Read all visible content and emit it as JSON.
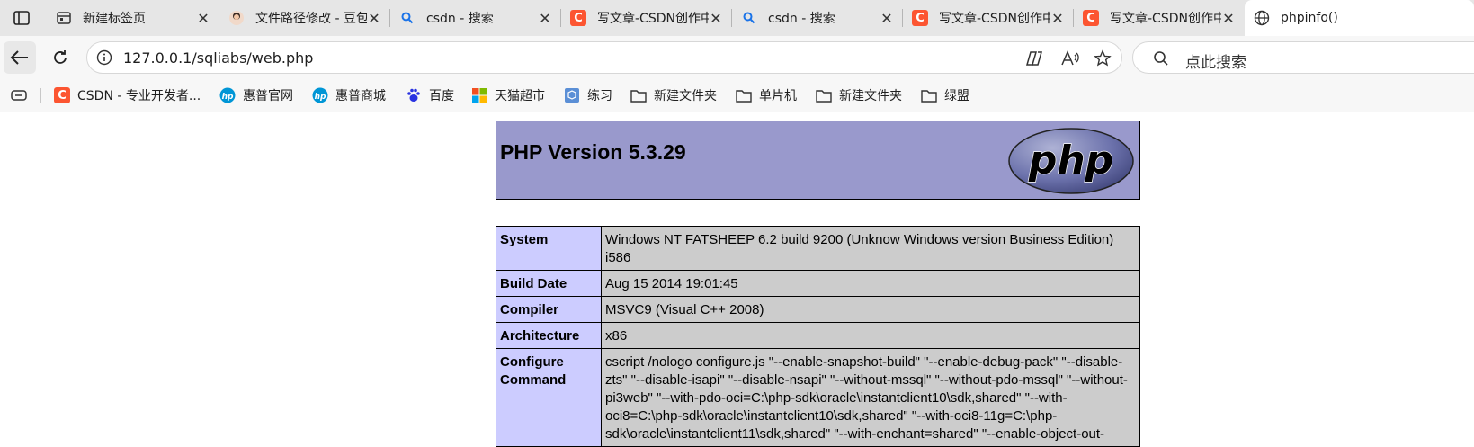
{
  "tabs": [
    {
      "label": "新建标签页",
      "icon": "new-tab-icon"
    },
    {
      "label": "文件路径修改 - 豆包",
      "icon": "doubao-avatar-icon"
    },
    {
      "label": "csdn - 搜索",
      "icon": "search-icon"
    },
    {
      "label": "写文章-CSDN创作中心",
      "icon": "csdn-icon"
    },
    {
      "label": "csdn - 搜索",
      "icon": "search-icon"
    },
    {
      "label": "写文章-CSDN创作中心",
      "icon": "csdn-icon"
    },
    {
      "label": "写文章-CSDN创作中心",
      "icon": "csdn-icon"
    },
    {
      "label": "phpinfo()",
      "icon": "globe-icon",
      "active": true
    }
  ],
  "address_bar": {
    "url": "127.0.0.1/sqliabs/web.php"
  },
  "search_box": {
    "placeholder": "点此搜索"
  },
  "bookmarks": [
    {
      "label": "CSDN - 专业开发者...",
      "icon": "csdn-icon"
    },
    {
      "label": "惠普官网",
      "icon": "hp-icon"
    },
    {
      "label": "惠普商城",
      "icon": "hp-icon"
    },
    {
      "label": "百度",
      "icon": "baidu-icon"
    },
    {
      "label": "天猫超市",
      "icon": "tmall-icon"
    },
    {
      "label": "练习",
      "icon": "cube-icon"
    },
    {
      "label": "新建文件夹",
      "icon": "folder-icon"
    },
    {
      "label": "单片机",
      "icon": "folder-icon"
    },
    {
      "label": "新建文件夹",
      "icon": "folder-icon"
    },
    {
      "label": "绿盟",
      "icon": "folder-icon"
    }
  ],
  "phpinfo": {
    "title": "PHP Version 5.3.29",
    "logo_text": "php",
    "rows": [
      {
        "key": "System",
        "value": "Windows NT FATSHEEP 6.2 build 9200 (Unknow Windows version Business Edition) i586"
      },
      {
        "key": "Build Date",
        "value": "Aug 15 2014 19:01:45"
      },
      {
        "key": "Compiler",
        "value": "MSVC9 (Visual C++ 2008)"
      },
      {
        "key": "Architecture",
        "value": "x86"
      },
      {
        "key": "Configure Command",
        "value": "cscript /nologo configure.js \"--enable-snapshot-build\" \"--enable-debug-pack\" \"--disable-zts\" \"--disable-isapi\" \"--disable-nsapi\" \"--without-mssql\" \"--without-pdo-mssql\" \"--without-pi3web\" \"--with-pdo-oci=C:\\php-sdk\\oracle\\instantclient10\\sdk,shared\" \"--with-oci8=C:\\php-sdk\\oracle\\instantclient10\\sdk,shared\" \"--with-oci8-11g=C:\\php-sdk\\oracle\\instantclient11\\sdk,shared\" \"--with-enchant=shared\" \"--enable-object-out-"
      }
    ]
  },
  "colors": {
    "php_header": "#9999cc",
    "key_cell": "#ccccff",
    "value_cell": "#cccccc",
    "csdn": "#fc5531"
  }
}
